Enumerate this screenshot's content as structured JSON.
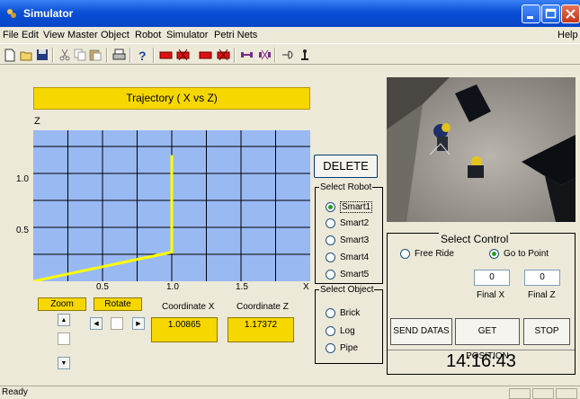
{
  "window": {
    "title": "Simulator",
    "menu": [
      "File",
      "Edit",
      "View",
      "Master",
      "Object",
      "Robot",
      "Simulator",
      "Petri Nets"
    ],
    "help": "Help"
  },
  "toolbar": {
    "icons": [
      "new-file-icon",
      "open-folder-icon",
      "save-icon",
      "cut-icon",
      "copy-icon",
      "paste-icon",
      "print-icon",
      "help-icon",
      "robot-red-icon",
      "robot-red-x-icon",
      "robot-red-icon-2",
      "robot-red-x-icon-2",
      "link-icon",
      "unlink-icon",
      "mode-icon",
      "anchor-icon"
    ]
  },
  "trajectory": {
    "title": "Trajectory ( X vs Z)",
    "y_axis_label": "Z",
    "x_axis_label": "X"
  },
  "chart_data": {
    "type": "line",
    "title": "Trajectory ( X vs Z)",
    "xlabel": "X",
    "ylabel": "Z",
    "xlim": [
      0.0,
      2.0
    ],
    "ylim": [
      0.0,
      1.4
    ],
    "x_ticks": [
      "0.5",
      "1.0",
      "1.5"
    ],
    "y_ticks": [
      "0.5",
      "1.0"
    ],
    "grid": true,
    "background": "#99b9f3",
    "line_color": "#ffff00",
    "series": [
      {
        "x": [
          0.0,
          1.0,
          1.0
        ],
        "y": [
          0.0,
          0.27,
          1.17
        ]
      }
    ]
  },
  "controls": {
    "zoom": "Zoom",
    "rotate": "Rotate",
    "coord_x_label": "Coordinate X",
    "coord_z_label": "Coordinate Z",
    "coord_x_value": "1.00865",
    "coord_z_value": "1.17372"
  },
  "delete_label": "DELETE",
  "select_robot": {
    "legend": "Select Robot",
    "options": [
      "Smart1",
      "Smart2",
      "Smart3",
      "Smart4",
      "Smart5"
    ],
    "selected": 0
  },
  "select_object": {
    "legend": "Select Object",
    "options": [
      "Brick",
      "Log",
      "Pipe"
    ]
  },
  "select_control": {
    "title": "Select Control",
    "free_ride": "Free Ride",
    "go_to_point": "Go to Point",
    "final_x_value": "0",
    "final_z_value": "0",
    "final_x_label": "Final X",
    "final_z_label": "Final Z",
    "send_datas": "SEND DATAS",
    "get_position": "GET POSITION",
    "stop": "STOP",
    "clock": "14:16:43"
  },
  "status": {
    "text": "Ready"
  }
}
